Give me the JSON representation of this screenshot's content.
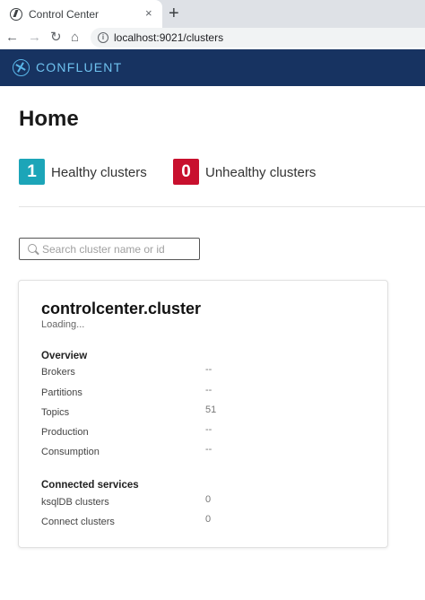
{
  "browser": {
    "tab_title": "Control Center",
    "tab_close": "×",
    "new_tab": "+",
    "url": "localhost:9021/clusters",
    "info": "i",
    "nav": {
      "back": "←",
      "forward": "→",
      "reload": "↻",
      "home": "⌂"
    }
  },
  "header": {
    "brand": "CONFLUENT"
  },
  "page": {
    "title": "Home"
  },
  "stats": {
    "healthy_count": "1",
    "healthy_label": "Healthy clusters",
    "healthy_color": "#1ca5b8",
    "unhealthy_count": "0",
    "unhealthy_label": "Unhealthy clusters",
    "unhealthy_color": "#c8102e"
  },
  "search": {
    "placeholder": "Search cluster name or id",
    "value": ""
  },
  "cluster": {
    "name": "controlcenter.cluster",
    "status": "Loading...",
    "overview_title": "Overview",
    "overview": [
      {
        "label": "Brokers",
        "value": "--"
      },
      {
        "label": "Partitions",
        "value": "--"
      },
      {
        "label": "Topics",
        "value": "51"
      },
      {
        "label": "Production",
        "value": "--"
      },
      {
        "label": "Consumption",
        "value": "--"
      }
    ],
    "services_title": "Connected services",
    "services": [
      {
        "label": "ksqlDB clusters",
        "value": "0"
      },
      {
        "label": "Connect clusters",
        "value": "0"
      }
    ]
  },
  "colors": {
    "header_bg": "#173361",
    "brand": "#6fc2ef"
  }
}
